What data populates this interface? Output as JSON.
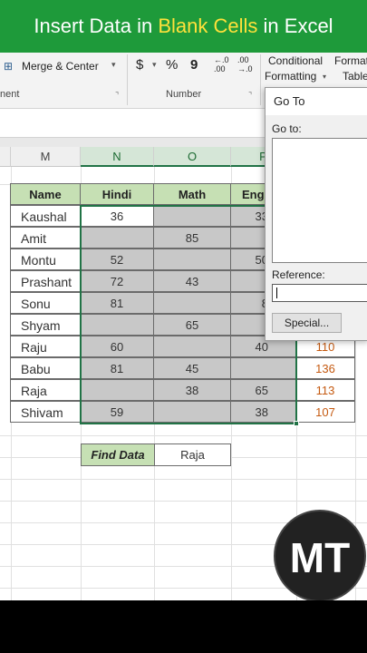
{
  "banner": {
    "part1": "Insert Data ",
    "part2": "in ",
    "part3": "Blank Cells ",
    "part4": "in Excel"
  },
  "ribbon": {
    "partial_left_label": "nent",
    "merge_center": "Merge & Center",
    "dropdown_glyph": "▾",
    "dollar": "$",
    "percent": "%",
    "comma": "9",
    "dec_increase": "←.0\n.00",
    "dec_decrease": ".00\n→.0",
    "number_group": "Number",
    "conditional_formatting_line1": "Conditional",
    "conditional_formatting_line2": "Formatting",
    "format_table_line1": "Format",
    "format_table_line2": "Table",
    "launcher_glyph": "⌝"
  },
  "columns": {
    "m": "M",
    "n": "N",
    "o": "O",
    "p": "P"
  },
  "table": {
    "headers": [
      "Name",
      "Hindi",
      "Math",
      "Eng"
    ],
    "rows": [
      {
        "name": "Kaushal",
        "hindi": "36",
        "math": "",
        "eng": "33",
        "total": ""
      },
      {
        "name": "Amit",
        "hindi": "",
        "math": "85",
        "eng": "",
        "total": ""
      },
      {
        "name": "Montu",
        "hindi": "52",
        "math": "",
        "eng": "50",
        "total": ""
      },
      {
        "name": "Prashant",
        "hindi": "72",
        "math": "43",
        "eng": "",
        "total": ""
      },
      {
        "name": "Sonu",
        "hindi": "81",
        "math": "",
        "eng": "8",
        "total": ""
      },
      {
        "name": "Shyam",
        "hindi": "",
        "math": "65",
        "eng": "",
        "total": ""
      },
      {
        "name": "Raju",
        "hindi": "60",
        "math": "",
        "eng": "40",
        "total": "110"
      },
      {
        "name": "Babu",
        "hindi": "81",
        "math": "45",
        "eng": "",
        "total": "136"
      },
      {
        "name": "Raja",
        "hindi": "",
        "math": "38",
        "eng": "65",
        "total": "113"
      },
      {
        "name": "Shivam",
        "hindi": "59",
        "math": "",
        "eng": "38",
        "total": "107"
      }
    ]
  },
  "find": {
    "label": "Find Data",
    "value": "Raja"
  },
  "goto_dialog": {
    "title": "Go To",
    "goto_label": "Go to:",
    "reference_label": "Reference:",
    "reference_value": "",
    "special_button": "Special..."
  },
  "logo": {
    "text": "MT"
  },
  "colors": {
    "banner_bg": "#1e9a3a",
    "banner_highlight": "#ffe13a",
    "header_fill": "#c6e0b4",
    "selection_gray": "#c8c8c8",
    "excel_green": "#217346",
    "total_orange": "#c55a11"
  }
}
